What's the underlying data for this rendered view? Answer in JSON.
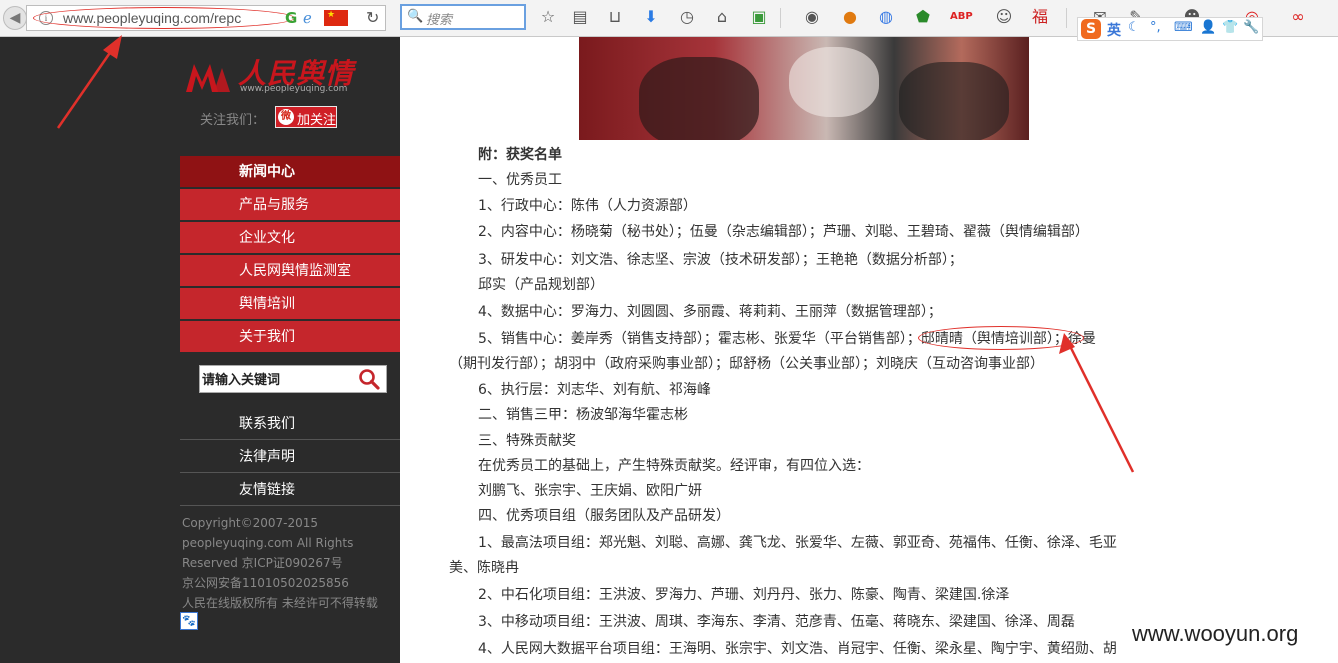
{
  "browser": {
    "url": "www.peopleyuqing.com/repc",
    "search_placeholder": "搜索",
    "ime_lang": "英"
  },
  "sidebar": {
    "logo_cn": "人民舆情",
    "logo_url": "www.peopleyuqing.com",
    "follow_label": "关注我们：",
    "follow_button": "加关注",
    "nav": [
      {
        "label": "新闻中心",
        "active": true
      },
      {
        "label": "产品与服务"
      },
      {
        "label": "企业文化"
      },
      {
        "label": "人民网舆情监测室"
      },
      {
        "label": "舆情培训"
      },
      {
        "label": "关于我们"
      }
    ],
    "search_value": "请输入关键词",
    "links": [
      {
        "label": "联系我们"
      },
      {
        "label": "法律声明"
      },
      {
        "label": "友情链接"
      }
    ],
    "copyright": [
      "Copyright©2007-2015",
      "peopleyuqing.com All Rights",
      "Reserved 京ICP证090267号",
      "京公网安备11010502025856",
      "人民在线版权所有 未经许可不得转载"
    ]
  },
  "article": {
    "lines": [
      {
        "text": "附：获奖名单",
        "bold": true,
        "indent": true
      },
      {
        "text": "一、优秀员工",
        "indent": true
      },
      {
        "text": "1、行政中心：陈伟（人力资源部）",
        "indent": true
      },
      {
        "text": "2、内容中心：杨晓菊（秘书处）；伍曼（杂志编辑部）；芦珊、刘聪、王碧琦、翟薇（舆情编辑部）",
        "indent": true
      },
      {
        "text": "3、研发中心：刘文浩、徐志坚、宗波（技术研发部）；王艳艳（数据分析部）；",
        "indent": true
      },
      {
        "text": "邱实（产品规划部）",
        "indent": true
      },
      {
        "text": "4、数据中心：罗海力、刘圆圆、多丽霞、蒋莉莉、王丽萍（数据管理部）；",
        "indent": true
      },
      {
        "text": "5、销售中心：姜岸秀（销售支持部）；霍志彬、张爱华（平台销售部）；邸晴晴（舆情培训部）；徐曼",
        "indent": true
      },
      {
        "text": "（期刊发行部）；胡羽中（政府采购事业部）；邸舒杨（公关事业部）；刘晓庆（互动咨询事业部）",
        "indent": false
      },
      {
        "text": "6、执行层：刘志华、刘有航、祁海峰",
        "indent": true
      },
      {
        "text": "二、销售三甲：杨波邹海华霍志彬",
        "indent": true
      },
      {
        "text": "三、特殊贡献奖",
        "indent": true
      },
      {
        "text": "在优秀员工的基础上，产生特殊贡献奖。经评审，有四位入选：",
        "indent": true
      },
      {
        "text": "刘鹏飞、张宗宇、王庆娟、欧阳广妍",
        "indent": true
      },
      {
        "text": "四、优秀项目组（服务团队及产品研发）",
        "indent": true
      },
      {
        "text": "1、最高法项目组：郑光魁、刘聪、高娜、龚飞龙、张爱华、左薇、郭亚奇、苑福伟、任衡、徐泽、毛亚",
        "indent": true
      },
      {
        "text": "美、陈晓冉",
        "indent": false
      },
      {
        "text": "2、中石化项目组：王洪波、罗海力、芦珊、刘丹丹、张力、陈豪、陶青、梁建国.徐泽",
        "indent": true
      },
      {
        "text": "3、中移动项目组：王洪波、周琪、李海东、李清、范彦青、伍毫、蒋晓东、梁建国、徐泽、周磊",
        "indent": true
      },
      {
        "text": "4、人民网大数据平台项目组：王海明、张宗宇、刘文浩、肖冠宇、任衡、梁永星、陶宁宇、黄绍勋、胡",
        "indent": true
      }
    ]
  },
  "watermark": "www.wooyun.org",
  "colors": {
    "sidebar_bg": "#2b2b2b",
    "nav_red": "#c5262c",
    "nav_active": "#8f1214",
    "annotation_red": "#e0302a"
  }
}
